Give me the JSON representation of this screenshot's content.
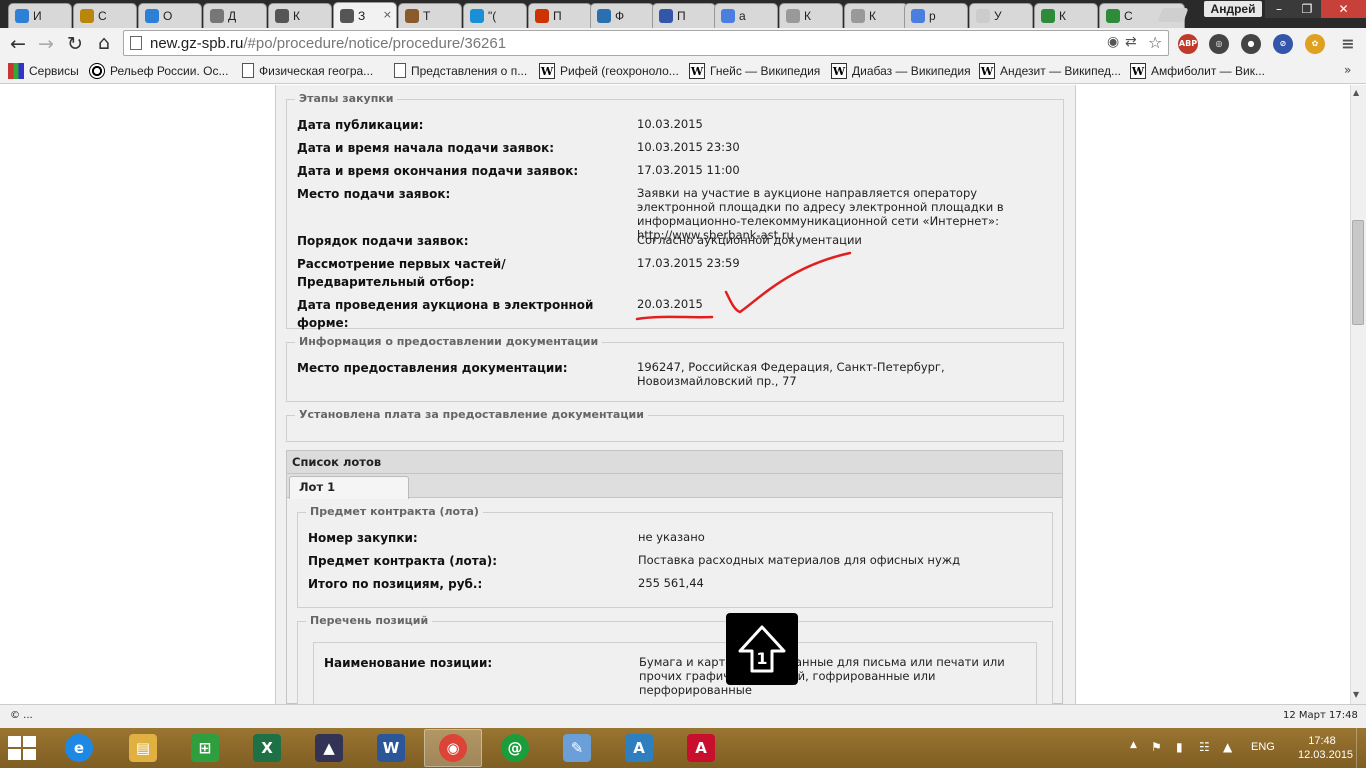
{
  "browser": {
    "tabs": [
      {
        "title": "И",
        "icon": "help-circle-icon",
        "color": "#2e7fd6"
      },
      {
        "title": "С",
        "icon": "coat-of-arms-icon",
        "color": "#b8860b"
      },
      {
        "title": "О",
        "icon": "help-circle-icon",
        "color": "#2e7fd6"
      },
      {
        "title": "Д",
        "icon": "star-icon",
        "color": "#777777"
      },
      {
        "title": "К",
        "icon": "gavel-icon",
        "color": "#555555"
      },
      {
        "title": "З",
        "icon": "gavel-icon",
        "color": "#555555"
      },
      {
        "title": "Т",
        "icon": "image-icon",
        "color": "#8b5a2b"
      },
      {
        "title": "\"(",
        "icon": "c-logo-icon",
        "color": "#1a8fd6"
      },
      {
        "title": "П",
        "icon": "ru-logo-icon",
        "color": "#cc3300"
      },
      {
        "title": "Ф",
        "icon": "globe-icon",
        "color": "#2a6fb0"
      },
      {
        "title": "П",
        "icon": "ipk-logo-icon",
        "color": "#3355aa"
      },
      {
        "title": "а",
        "icon": "google-g-icon",
        "color": "#4a7fe0"
      },
      {
        "title": "К",
        "icon": "document-icon",
        "color": "#999999"
      },
      {
        "title": "К",
        "icon": "document-icon",
        "color": "#999999"
      },
      {
        "title": "р",
        "icon": "google-g-icon",
        "color": "#4a7fe0"
      },
      {
        "title": "У",
        "icon": "blank-icon",
        "color": "#cccccc"
      },
      {
        "title": "К",
        "icon": "green-star-icon",
        "color": "#2e8b3a"
      },
      {
        "title": "С",
        "icon": "green-star-icon",
        "color": "#2e8b3a"
      }
    ],
    "user": "Андрей",
    "url_host": "new.gz-spb.ru",
    "url_path": "/#po/procedure/notice/procedure/36261",
    "window_controls": {
      "min": "–",
      "max": "❐",
      "close": "✕"
    },
    "bookmarks": [
      {
        "label": "Сервисы",
        "icon": "apps-grid-icon"
      },
      {
        "label": "Рельеф России. Ос...",
        "icon": "relief-icon"
      },
      {
        "label": "Физическая геогра...",
        "icon": "document-icon"
      },
      {
        "label": "Представления о п...",
        "icon": "document-icon"
      },
      {
        "label": "Рифей (геохроноло...",
        "icon": "wikipedia-icon"
      },
      {
        "label": "Гнейс — Википедия",
        "icon": "wikipedia-icon"
      },
      {
        "label": "Диабаз — Википедия",
        "icon": "wikipedia-icon"
      },
      {
        "label": "Андезит — Википед...",
        "icon": "wikipedia-icon"
      },
      {
        "label": "Амфиболит — Вик...",
        "icon": "wikipedia-icon"
      }
    ],
    "bookmarks_more": "»",
    "extensions": [
      {
        "name": "abp-icon",
        "label": "ABP",
        "color": "#c0392b"
      },
      {
        "name": "target-icon",
        "label": "◎",
        "color": "#444444"
      },
      {
        "name": "chat-icon",
        "label": "●",
        "color": "#444444"
      },
      {
        "name": "block-icon",
        "label": "⊘",
        "color": "#3355aa"
      },
      {
        "name": "paw-icon",
        "label": "✿",
        "color": "#e0a020"
      },
      {
        "name": "menu-icon",
        "label": "≡",
        "color": "#555555"
      }
    ]
  },
  "notice": {
    "stages": {
      "legend": "Этапы закупки",
      "rows": [
        {
          "label": "Дата публикации:",
          "value": "10.03.2015"
        },
        {
          "label": "Дата и время начала подачи заявок:",
          "value": "10.03.2015 23:30"
        },
        {
          "label": "Дата и время окончания подачи заявок:",
          "value": "17.03.2015 11:00"
        },
        {
          "label": "Место подачи заявок:",
          "value": "Заявки на участие в аукционе направляется оператору электронной площадки по адресу электронной площадки в информационно-телекоммуникационной сети «Интернет»: http://www.sberbank-ast.ru"
        },
        {
          "label": "Порядок подачи заявок:",
          "value": "Согласно аукционной документации"
        },
        {
          "label": "Рассмотрение первых частей/Предварительный отбор:",
          "value": "17.03.2015 23:59"
        },
        {
          "label": "Дата проведения аукциона в электронной форме:",
          "value": "20.03.2015"
        }
      ]
    },
    "docs_info": {
      "legend": "Информация о предоставлении документации",
      "rows": [
        {
          "label": "Место предоставления документации:",
          "value": "196247, Российская Федерация, Санкт-Петербург, Новоизмайловский пр., 77"
        }
      ]
    },
    "fee": {
      "legend": "Установлена плата за предоставление документации"
    },
    "lots": {
      "header": "Список лотов",
      "tab": "Лот 1",
      "subject": {
        "legend": "Предмет контракта (лота)",
        "rows": [
          {
            "label": "Номер закупки:",
            "value": "не указано"
          },
          {
            "label": "Предмет контракта (лота):",
            "value": "Поставка расходных материалов для офисных нужд"
          },
          {
            "label": "Итого по позициям, руб.:",
            "value": "255 561,44"
          }
        ]
      },
      "positions": {
        "legend": "Перечень позиций",
        "rows": [
          {
            "label": "Наименование позиции:",
            "value": "Бумага и картон немелованные для письма или печати или прочих графических целей, гофрированные или перфорированные"
          }
        ]
      }
    }
  },
  "status": {
    "left": "© ...",
    "right": "12 Март 17:48"
  },
  "taskbar": {
    "apps": [
      {
        "name": "ie",
        "icon": "internet-explorer-icon",
        "glyph": "e",
        "color": "#1e88e5"
      },
      {
        "name": "explorer",
        "icon": "file-explorer-icon",
        "glyph": "▤",
        "color": "#e0b040"
      },
      {
        "name": "store",
        "icon": "store-icon",
        "glyph": "⊞",
        "color": "#2e9e3e"
      },
      {
        "name": "excel",
        "icon": "excel-icon",
        "glyph": "X",
        "color": "#1e7145"
      },
      {
        "name": "graduate",
        "icon": "graduation-cap-icon",
        "glyph": "▲",
        "color": "#333355"
      },
      {
        "name": "word",
        "icon": "word-icon",
        "glyph": "W",
        "color": "#2b579a"
      },
      {
        "name": "chrome",
        "icon": "chrome-icon",
        "glyph": "◉",
        "color": "#db4437"
      },
      {
        "name": "mailru",
        "icon": "mail-agent-icon",
        "glyph": "@",
        "color": "#1a9e3a"
      },
      {
        "name": "paint",
        "icon": "paint-palette-icon",
        "glyph": "✎",
        "color": "#6a9fd8"
      },
      {
        "name": "adobe-app",
        "icon": "triangle-a-icon",
        "glyph": "A",
        "color": "#2d7fc0"
      },
      {
        "name": "acrobat",
        "icon": "acrobat-icon",
        "glyph": "A",
        "color": "#c8102e"
      }
    ],
    "lang": "ENG",
    "time": "17:48",
    "date": "12.03.2015"
  }
}
